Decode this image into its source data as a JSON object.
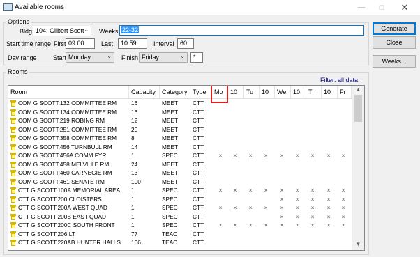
{
  "window": {
    "title": "Available rooms"
  },
  "options": {
    "group_label": "Options",
    "bldg_label": "Bldg",
    "bldg_value": "104: Gilbert Scott",
    "weeks_label": "Weeks",
    "weeks_value": "22-32",
    "start_time_label": "Start time range",
    "first_label": "First",
    "first_value": "09:00",
    "last_label": "Last",
    "last_value": "10:59",
    "interval_label": "Interval",
    "interval_value": "60",
    "day_range_label": "Day range",
    "start_label": "Start",
    "start_value": "Monday",
    "finish_label": "Finish",
    "finish_value": "Friday",
    "star_value": "*"
  },
  "buttons": {
    "generate": "Generate",
    "close": "Close",
    "weeks": "Weeks..."
  },
  "rooms": {
    "group_label": "Rooms",
    "filter_text": "Filter: all data",
    "columns": [
      "Room",
      "Capacity",
      "Category",
      "Type",
      "Mo",
      "10",
      "Tu",
      "10",
      "We",
      "10",
      "Th",
      "10",
      "Fr"
    ],
    "rows": [
      {
        "room": "COM G SCOTT:132 COMMITTEE RM",
        "capacity": "16",
        "category": "MEET",
        "type": "CTT",
        "marks": [
          "",
          "",
          "",
          "",
          "",
          "",
          "",
          "",
          ""
        ]
      },
      {
        "room": "COM G SCOTT:134 COMMITTEE RM",
        "capacity": "16",
        "category": "MEET",
        "type": "CTT",
        "marks": [
          "",
          "",
          "",
          "",
          "",
          "",
          "",
          "",
          ""
        ]
      },
      {
        "room": "COM G SCOTT:219 ROBING RM",
        "capacity": "12",
        "category": "MEET",
        "type": "CTT",
        "marks": [
          "",
          "",
          "",
          "",
          "",
          "",
          "",
          "",
          ""
        ]
      },
      {
        "room": "COM G SCOTT:251 COMMITTEE RM",
        "capacity": "20",
        "category": "MEET",
        "type": "CTT",
        "marks": [
          "",
          "",
          "",
          "",
          "",
          "",
          "",
          "",
          ""
        ]
      },
      {
        "room": "COM G SCOTT:358 COMMITTEE RM",
        "capacity": "8",
        "category": "MEET",
        "type": "CTT",
        "marks": [
          "",
          "",
          "",
          "",
          "",
          "",
          "",
          "",
          ""
        ]
      },
      {
        "room": "COM G SCOTT:456 TURNBULL RM",
        "capacity": "14",
        "category": "MEET",
        "type": "CTT",
        "marks": [
          "",
          "",
          "",
          "",
          "",
          "",
          "",
          "",
          ""
        ]
      },
      {
        "room": "COM G SCOTT:456A COMM FYR",
        "capacity": "1",
        "category": "SPEC",
        "type": "CTT",
        "marks": [
          "×",
          "×",
          "×",
          "×",
          "×",
          "×",
          "×",
          "×",
          "×"
        ]
      },
      {
        "room": "COM G SCOTT:458 MELVILLE RM",
        "capacity": "24",
        "category": "MEET",
        "type": "CTT",
        "marks": [
          "",
          "",
          "",
          "",
          "",
          "",
          "",
          "",
          ""
        ]
      },
      {
        "room": "COM G SCOTT:460 CARNEGIE RM",
        "capacity": "13",
        "category": "MEET",
        "type": "CTT",
        "marks": [
          "",
          "",
          "",
          "",
          "",
          "",
          "",
          "",
          ""
        ]
      },
      {
        "room": "COM G SCOTT:461 SENATE RM",
        "capacity": "100",
        "category": "MEET",
        "type": "CTT",
        "marks": [
          "",
          "",
          "",
          "",
          "",
          "",
          "",
          "",
          ""
        ]
      },
      {
        "room": "CTT G SCOTT:100A MEMORIAL AREA",
        "capacity": "1",
        "category": "SPEC",
        "type": "CTT",
        "marks": [
          "×",
          "×",
          "×",
          "×",
          "×",
          "×",
          "×",
          "×",
          "×"
        ]
      },
      {
        "room": "CTT G SCOTT:200 CLOISTERS",
        "capacity": "1",
        "category": "SPEC",
        "type": "CTT",
        "marks": [
          "",
          "",
          "",
          "",
          "×",
          "×",
          "×",
          "×",
          "×"
        ]
      },
      {
        "room": "CTT G SCOTT:200A WEST QUAD",
        "capacity": "1",
        "category": "SPEC",
        "type": "CTT",
        "marks": [
          "×",
          "×",
          "×",
          "×",
          "×",
          "×",
          "×",
          "×",
          "×"
        ]
      },
      {
        "room": "CTT G SCOTT:200B EAST QUAD",
        "capacity": "1",
        "category": "SPEC",
        "type": "CTT",
        "marks": [
          "",
          "",
          "",
          "",
          "×",
          "×",
          "×",
          "×",
          "×"
        ]
      },
      {
        "room": "CTT G SCOTT:200C SOUTH FRONT",
        "capacity": "1",
        "category": "SPEC",
        "type": "CTT",
        "marks": [
          "×",
          "×",
          "×",
          "×",
          "×",
          "×",
          "×",
          "×",
          "×"
        ]
      },
      {
        "room": "CTT G SCOTT:206 LT",
        "capacity": "77",
        "category": "TEAC",
        "type": "CTT",
        "marks": [
          "",
          "",
          "",
          "",
          "",
          "",
          "",
          "",
          ""
        ]
      },
      {
        "room": "CTT G SCOTT:220AB HUNTER HALLS",
        "capacity": "166",
        "category": "TEAC",
        "type": "CTT",
        "marks": [
          "",
          "",
          "",
          "",
          "",
          "",
          "",
          "",
          ""
        ]
      }
    ]
  },
  "colors": {
    "highlight": "#e02020",
    "selection": "#3399ff",
    "room_icon": "#d4b800"
  }
}
